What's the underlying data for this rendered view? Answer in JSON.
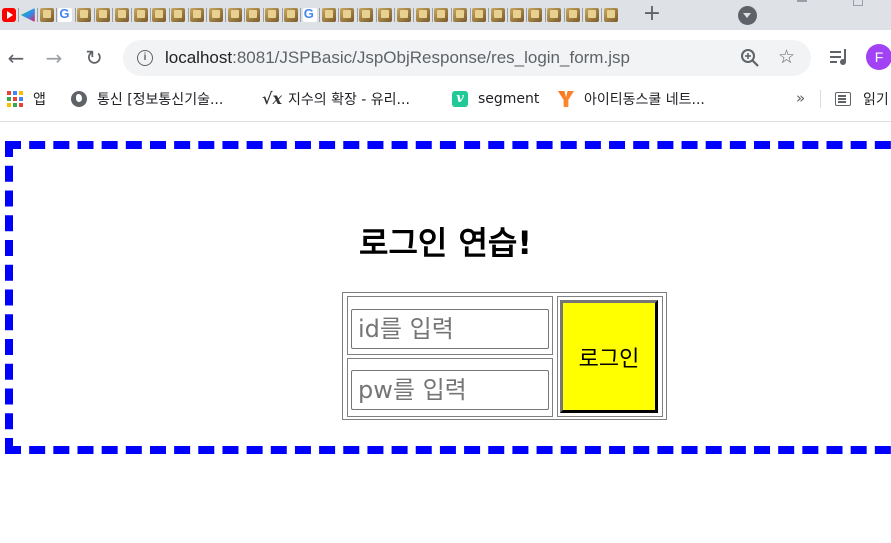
{
  "browser": {
    "tabs": [
      {
        "icon": "youtube-favicon-icon"
      },
      {
        "icon": "kotlin-favicon-icon"
      },
      {
        "icon": "jsp-favicon-icon"
      },
      {
        "icon": "google-favicon-icon"
      },
      {
        "icon": "jsp-favicon-icon"
      },
      {
        "icon": "jsp-favicon-icon"
      },
      {
        "icon": "jsp-favicon-icon"
      },
      {
        "icon": "jsp-favicon-icon"
      },
      {
        "icon": "jsp-favicon-icon"
      },
      {
        "icon": "jsp-favicon-icon"
      },
      {
        "icon": "jsp-favicon-icon"
      },
      {
        "icon": "jsp-favicon-icon"
      },
      {
        "icon": "jsp-favicon-icon"
      },
      {
        "icon": "jsp-favicon-icon"
      },
      {
        "icon": "jsp-favicon-icon"
      },
      {
        "icon": "jsp-favicon-icon"
      },
      {
        "icon": "google-favicon-icon"
      },
      {
        "icon": "jsp-favicon-icon"
      },
      {
        "icon": "jsp-favicon-icon"
      },
      {
        "icon": "jsp-favicon-icon"
      },
      {
        "icon": "jsp-favicon-icon"
      },
      {
        "icon": "jsp-favicon-icon"
      },
      {
        "icon": "jsp-favicon-icon"
      },
      {
        "icon": "jsp-favicon-icon"
      },
      {
        "icon": "jsp-favicon-icon"
      },
      {
        "icon": "jsp-favicon-icon"
      },
      {
        "icon": "jsp-favicon-icon"
      },
      {
        "icon": "jsp-favicon-icon"
      },
      {
        "icon": "jsp-favicon-icon"
      },
      {
        "icon": "jsp-favicon-icon"
      },
      {
        "icon": "jsp-favicon-icon"
      },
      {
        "icon": "jsp-favicon-icon"
      },
      {
        "icon": "jsp-favicon-icon"
      }
    ],
    "new_tab": "+",
    "url_host": "localhost",
    "url_path": ":8081/JSPBasic/JspObjResponse/res_login_form.jsp",
    "profile_initial": "F",
    "bookmarks": [
      {
        "label": "앱",
        "icon": "apps-icon"
      },
      {
        "label": "통신 [정보통신기술...",
        "icon": "globe-icon"
      },
      {
        "label": "지수의 확장 - 유리...",
        "icon": "sqrt-icon"
      },
      {
        "label": "segment",
        "icon": "v-icon"
      },
      {
        "label": "아이티동스쿨 네트...",
        "icon": "itdong-icon"
      }
    ],
    "bookmarks_more": "»",
    "reading_list": "읽기"
  },
  "page": {
    "title": "로그인 연습!",
    "id_placeholder": "id를 입력",
    "pw_placeholder": "pw를 입력",
    "login_button": "로그인"
  },
  "colors": {
    "border_accent": "#0000ff",
    "button_bg": "#ffff00"
  }
}
